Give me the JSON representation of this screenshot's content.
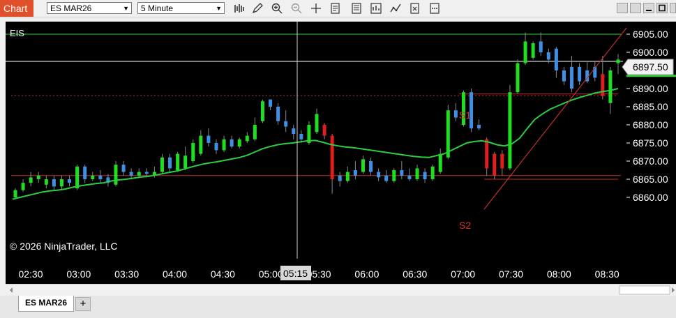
{
  "window": {
    "tab_label": "Chart"
  },
  "toolbar": {
    "instrument": "ES MAR26",
    "interval": "5 Minute",
    "icons": [
      "bars-type-icon",
      "drawing-tool-icon",
      "zoom-in-icon",
      "zoom-out-icon",
      "crosshair-icon",
      "data-box-icon",
      "properties-icon",
      "strategies-icon",
      "indicators-icon",
      "templates-icon",
      "more-icon"
    ]
  },
  "chart": {
    "indicator_label": "EIS",
    "copyright": "© 2026 NinjaTrader, LLC",
    "crosshair_time": "05:15",
    "last_price": "6897.50",
    "s1_label": "S1",
    "s2_label": "S2"
  },
  "bottom_tabs": {
    "instrument_tab": "ES MAR26",
    "add_label": "+"
  },
  "chart_data": {
    "type": "candlestick",
    "price_axis_ticks": [
      "6905.00",
      "6900.00",
      "6895.00",
      "6890.00",
      "6885.00",
      "6880.00",
      "6875.00",
      "6870.00",
      "6865.00",
      "6860.00"
    ],
    "price_axis_values": [
      6905,
      6900,
      6895,
      6890,
      6885,
      6880,
      6875,
      6870,
      6865,
      6860
    ],
    "time_axis_ticks": [
      "02:30",
      "03:00",
      "03:30",
      "04:00",
      "04:30",
      "05:00",
      "05:30",
      "06:00",
      "06:30",
      "07:00",
      "07:30",
      "08:00",
      "08:30"
    ],
    "ylim": [
      6857.5,
      6907.5
    ],
    "horizontal_levels": [
      {
        "value": 6905.0,
        "color": "#2ecc40",
        "style": "solid"
      },
      {
        "value": 6897.5,
        "color": "#ffffff",
        "style": "solid"
      },
      {
        "value": 6888.5,
        "color": "#c0302e",
        "style": "solid"
      },
      {
        "value": 6888.0,
        "color": "#c0302e",
        "style": "dotted"
      },
      {
        "value": 6866.0,
        "color": "#c0302e",
        "style": "solid"
      },
      {
        "value": 6865.0,
        "color": "#c0302e",
        "style": "solid"
      }
    ],
    "candles": [
      [
        "g",
        6860,
        6862,
        6859.5,
        6862.5
      ],
      [
        "g",
        6862,
        6864,
        6861.5,
        6865
      ],
      [
        "g",
        6864,
        6865.5,
        6863,
        6867
      ],
      [
        "g",
        6865,
        6866,
        6864,
        6867
      ],
      [
        "g",
        6863.5,
        6865,
        6862.5,
        6866
      ],
      [
        "b",
        6865,
        6863,
        6862,
        6866
      ],
      [
        "g",
        6863,
        6865,
        6862,
        6866
      ],
      [
        "b",
        6865,
        6864,
        6863,
        6866
      ],
      [
        "g",
        6862.5,
        6868.5,
        6862,
        6869
      ],
      [
        "b",
        6868.5,
        6865,
        6864,
        6869
      ],
      [
        "g",
        6865,
        6866,
        6864.5,
        6867
      ],
      [
        "b",
        6866,
        6865,
        6864,
        6867.5
      ],
      [
        "b",
        6865.5,
        6864,
        6863,
        6866.5
      ],
      [
        "g",
        6863.5,
        6869,
        6863,
        6870
      ],
      [
        "b",
        6869,
        6867,
        6866,
        6870
      ],
      [
        "b",
        6867,
        6866,
        6865,
        6868
      ],
      [
        "g",
        6866,
        6867,
        6865.5,
        6868
      ],
      [
        "b",
        6867,
        6866.5,
        6865.5,
        6868
      ],
      [
        "g",
        6866,
        6867,
        6865.5,
        6868.5
      ],
      [
        "g",
        6867,
        6871,
        6866.5,
        6872
      ],
      [
        "b",
        6871,
        6868,
        6867,
        6872
      ],
      [
        "g",
        6867.5,
        6872,
        6867,
        6872.5
      ],
      [
        "g",
        6868,
        6871.5,
        6867.5,
        6874
      ],
      [
        "g",
        6870,
        6875,
        6869.5,
        6876
      ],
      [
        "g",
        6872,
        6877,
        6871.5,
        6878.5
      ],
      [
        "b",
        6877,
        6875,
        6874,
        6879
      ],
      [
        "b",
        6875,
        6873,
        6872,
        6876
      ],
      [
        "g",
        6873,
        6876,
        6872.5,
        6877
      ],
      [
        "b",
        6876,
        6874,
        6873.5,
        6877
      ],
      [
        "g",
        6874,
        6876,
        6873.5,
        6876.5
      ],
      [
        "g",
        6875.5,
        6877,
        6875,
        6878
      ],
      [
        "g",
        6876,
        6880,
        6875.5,
        6882
      ],
      [
        "g",
        6881,
        6886.5,
        6880.5,
        6887
      ],
      [
        "b",
        6887,
        6885,
        6884,
        6887
      ],
      [
        "b",
        6885,
        6881,
        6880,
        6886
      ],
      [
        "b",
        6881,
        6879.5,
        6878,
        6884
      ],
      [
        "b",
        6879,
        6877.5,
        6876,
        6880
      ],
      [
        "b",
        6877.5,
        6876,
        6875,
        6878.5
      ],
      [
        "g",
        6875,
        6880,
        6874.5,
        6881
      ],
      [
        "g",
        6878,
        6883,
        6877.5,
        6884.5
      ],
      [
        "r",
        6880,
        6877,
        6876,
        6880.5
      ],
      [
        "r",
        6877,
        6865,
        6861,
        6877.5
      ],
      [
        "b",
        6866,
        6864.5,
        6863,
        6867
      ],
      [
        "g",
        6864.5,
        6867,
        6864,
        6868.5
      ],
      [
        "b",
        6867.5,
        6866,
        6865,
        6870
      ],
      [
        "g",
        6867,
        6870.5,
        6866.5,
        6871.5
      ],
      [
        "b",
        6870,
        6867,
        6866,
        6871
      ],
      [
        "b",
        6867,
        6865.5,
        6864.5,
        6868
      ],
      [
        "b",
        6866,
        6864.5,
        6864,
        6867.5
      ],
      [
        "g",
        6864.5,
        6867.5,
        6864,
        6868
      ],
      [
        "b",
        6867.5,
        6866,
        6865,
        6870
      ],
      [
        "b",
        6866,
        6865,
        6864.5,
        6868
      ],
      [
        "g",
        6865,
        6868,
        6864.5,
        6869
      ],
      [
        "b",
        6867,
        6865,
        6864,
        6868
      ],
      [
        "g",
        6865,
        6868.5,
        6864.5,
        6869
      ],
      [
        "g",
        6867,
        6872,
        6866.5,
        6873.5
      ],
      [
        "g",
        6871,
        6884,
        6870.5,
        6885.5
      ],
      [
        "b",
        6884,
        6882,
        6881,
        6886
      ],
      [
        "g",
        6880,
        6889,
        6879.5,
        6889.5
      ],
      [
        "b",
        6889,
        6879,
        6878,
        6890
      ],
      [
        "b",
        6879,
        6880,
        6878.5,
        6881.5
      ],
      [
        "r",
        6876,
        6868,
        6866,
        6876.5
      ],
      [
        "r",
        6872,
        6866,
        6865,
        6872.5
      ],
      [
        "r",
        6872,
        6868,
        6866,
        6873
      ],
      [
        "g",
        6868,
        6889,
        6867.5,
        6891
      ],
      [
        "g",
        6889,
        6897,
        6888.5,
        6898
      ],
      [
        "g",
        6897,
        6903,
        6896.5,
        6905.5
      ],
      [
        "g",
        6898.5,
        6902.5,
        6898,
        6903
      ],
      [
        "b",
        6903,
        6900,
        6899,
        6905.5
      ],
      [
        "b",
        6900,
        6898,
        6897,
        6901
      ],
      [
        "b",
        6901,
        6895,
        6893,
        6901.5
      ],
      [
        "b",
        6895,
        6892,
        6891,
        6896
      ],
      [
        "b",
        6896,
        6890,
        6889,
        6899
      ],
      [
        "b",
        6896,
        6892,
        6891,
        6897
      ],
      [
        "b",
        6895,
        6892,
        6891.5,
        6897.5
      ],
      [
        "b",
        6896,
        6893,
        6892,
        6897.5
      ],
      [
        "r",
        6894,
        6888,
        6887,
        6899
      ],
      [
        "g",
        6886,
        6895,
        6883,
        6896
      ],
      [
        "g",
        6897,
        6898,
        6894,
        6899.5
      ]
    ],
    "ema": [
      6859.5,
      6860,
      6860.5,
      6861,
      6861.5,
      6861.8,
      6862,
      6862.3,
      6862.8,
      6863.2,
      6863.5,
      6863.8,
      6864,
      6864.5,
      6864.8,
      6865,
      6865.3,
      6865.6,
      6865.8,
      6866.2,
      6866.6,
      6867,
      6867.4,
      6868,
      6868.6,
      6869.1,
      6869.5,
      6869.8,
      6870.2,
      6870.6,
      6871,
      6871.6,
      6872.5,
      6873.4,
      6874,
      6874.5,
      6874.8,
      6875,
      6875.3,
      6875.6,
      6875.7,
      6875.2,
      6874.6,
      6874.2,
      6873.9,
      6873.7,
      6873.4,
      6873.1,
      6872.8,
      6872.5,
      6872.2,
      6871.9,
      6871.6,
      6871.3,
      6871.1,
      6871,
      6871.5,
      6872,
      6873,
      6874,
      6875,
      6875.4,
      6875.6,
      6875.2,
      6874.5,
      6874.2,
      6874.8,
      6876.3,
      6879,
      6881.5,
      6883,
      6884.3,
      6885.2,
      6886.1,
      6886.9,
      6887.6,
      6888.2,
      6888.8,
      6889.2,
      6889.5,
      6890
    ]
  }
}
